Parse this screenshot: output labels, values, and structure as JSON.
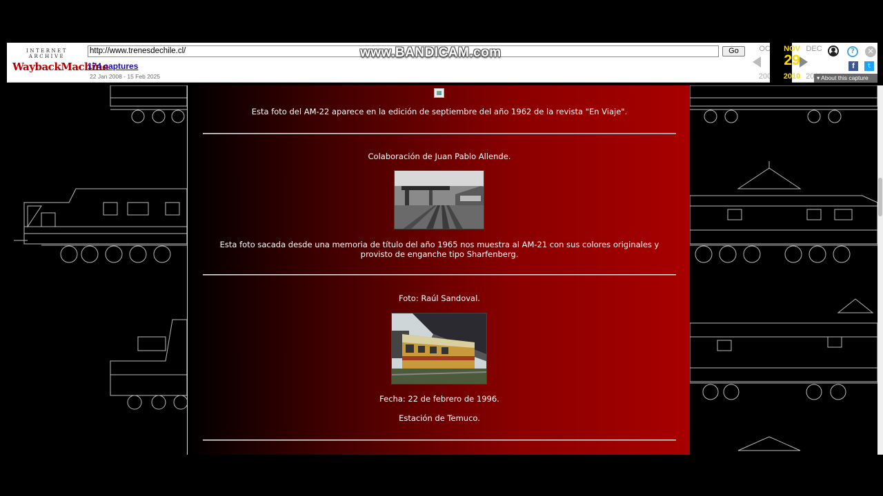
{
  "wayback": {
    "logo_top": "INTERNET ARCHIVE",
    "logo_main": "WaybackMachine",
    "url": "http://www.trenesdechile.cl/",
    "go_label": "Go",
    "captures": "174 captures",
    "range": "22 Jan 2008 - 15 Feb 2025",
    "prev_month": "OCT",
    "prev_year": "2009",
    "cur_month": "NOV",
    "cur_day": "29",
    "cur_year": "2010",
    "next_month": "DEC",
    "next_year": "2011",
    "about": "About this capture",
    "help_glyph": "?",
    "close_glyph": "✕",
    "fb_glyph": "f",
    "tw_glyph": "t"
  },
  "watermark": "www.BANDICAM.com",
  "content": {
    "caption_am22": "Esta foto del AM-22 aparece en la edición de septiembre del año 1962 de la revista \"En Viaje\".",
    "credit_allende": "Colaboración de Juan Pablo Allende.",
    "caption_am21": "Esta foto sacada desde una memoria de título del año 1965 nos muestra al AM-21 con sus colores originales y provisto de enganche tipo Sharfenberg.",
    "credit_sandoval": "Foto: Raúl Sandoval.",
    "date": "Fecha: 22 de febrero de 1996.",
    "station": "Estación de Temuco."
  },
  "colors": {
    "content_gradient_end": "#a80000",
    "wayback_accent": "#ffd900"
  }
}
